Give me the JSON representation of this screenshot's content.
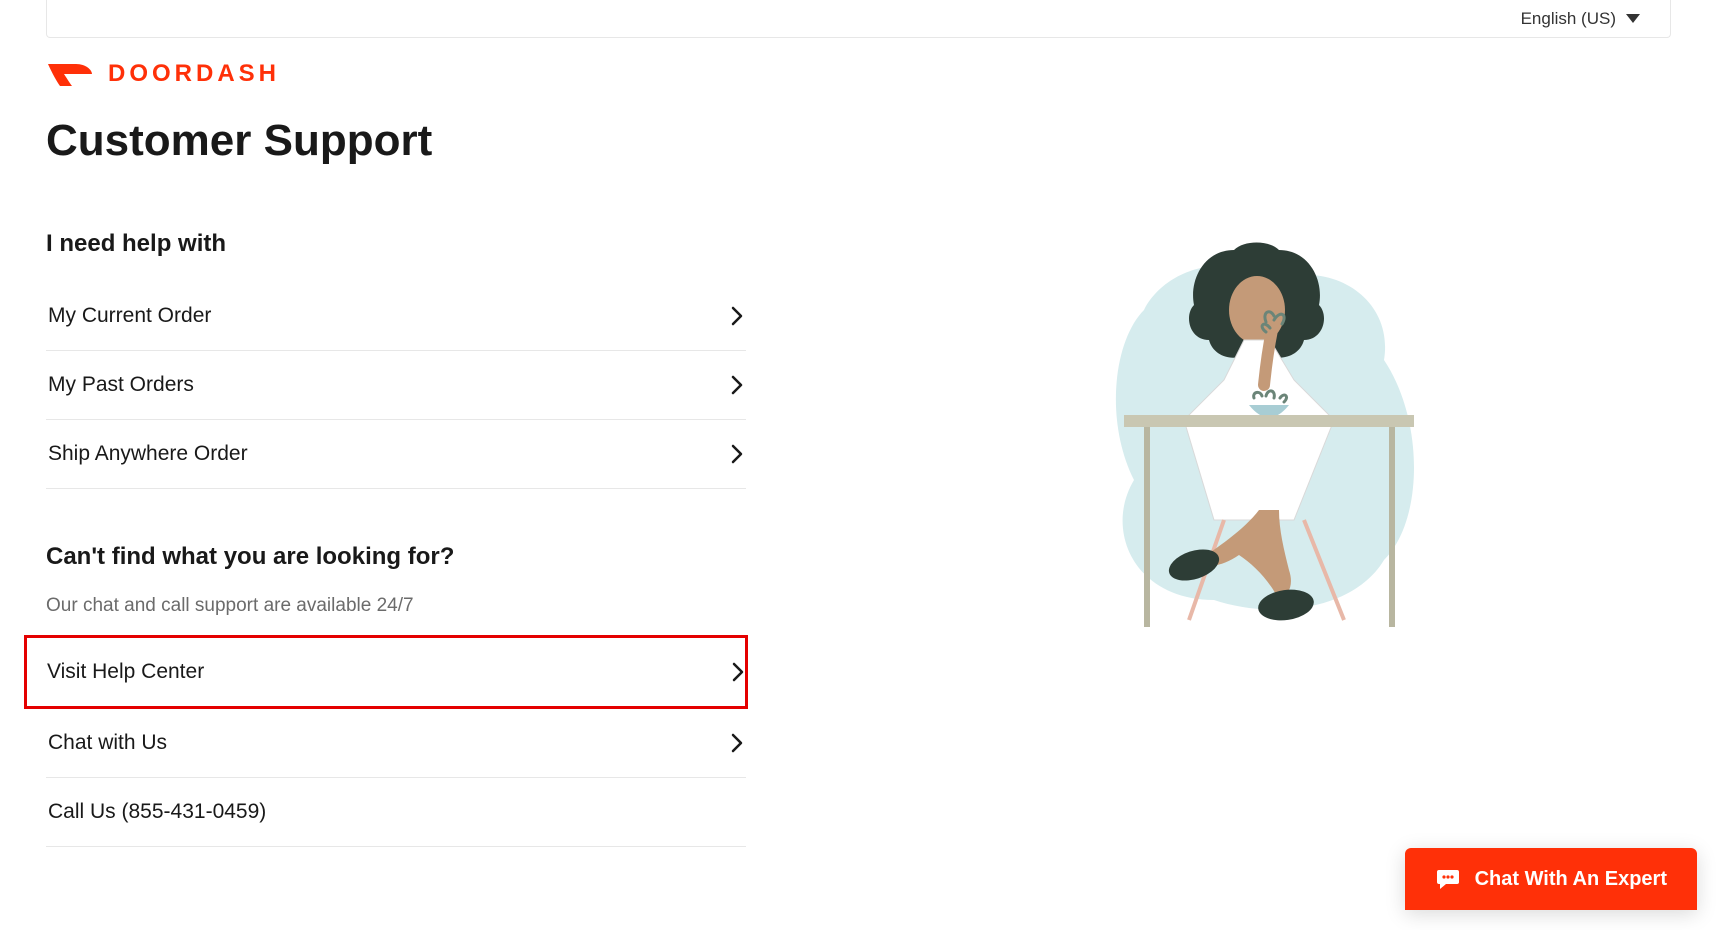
{
  "language": {
    "label": "English (US)"
  },
  "brand": {
    "name": "DOORDASH"
  },
  "page": {
    "title": "Customer Support"
  },
  "help": {
    "heading": "I need help with",
    "items": [
      {
        "label": "My Current Order"
      },
      {
        "label": "My Past Orders"
      },
      {
        "label": "Ship Anywhere Order"
      }
    ]
  },
  "more": {
    "heading": "Can't find what you are looking for?",
    "sub": "Our chat and call support are available 24/7",
    "items": [
      {
        "label": "Visit Help Center",
        "highlighted": true,
        "chevron": true
      },
      {
        "label": "Chat with Us",
        "highlighted": false,
        "chevron": true
      },
      {
        "label": "Call Us (855-431-0459)",
        "highlighted": false,
        "chevron": false
      }
    ]
  },
  "chat": {
    "label": "Chat With An Expert"
  }
}
